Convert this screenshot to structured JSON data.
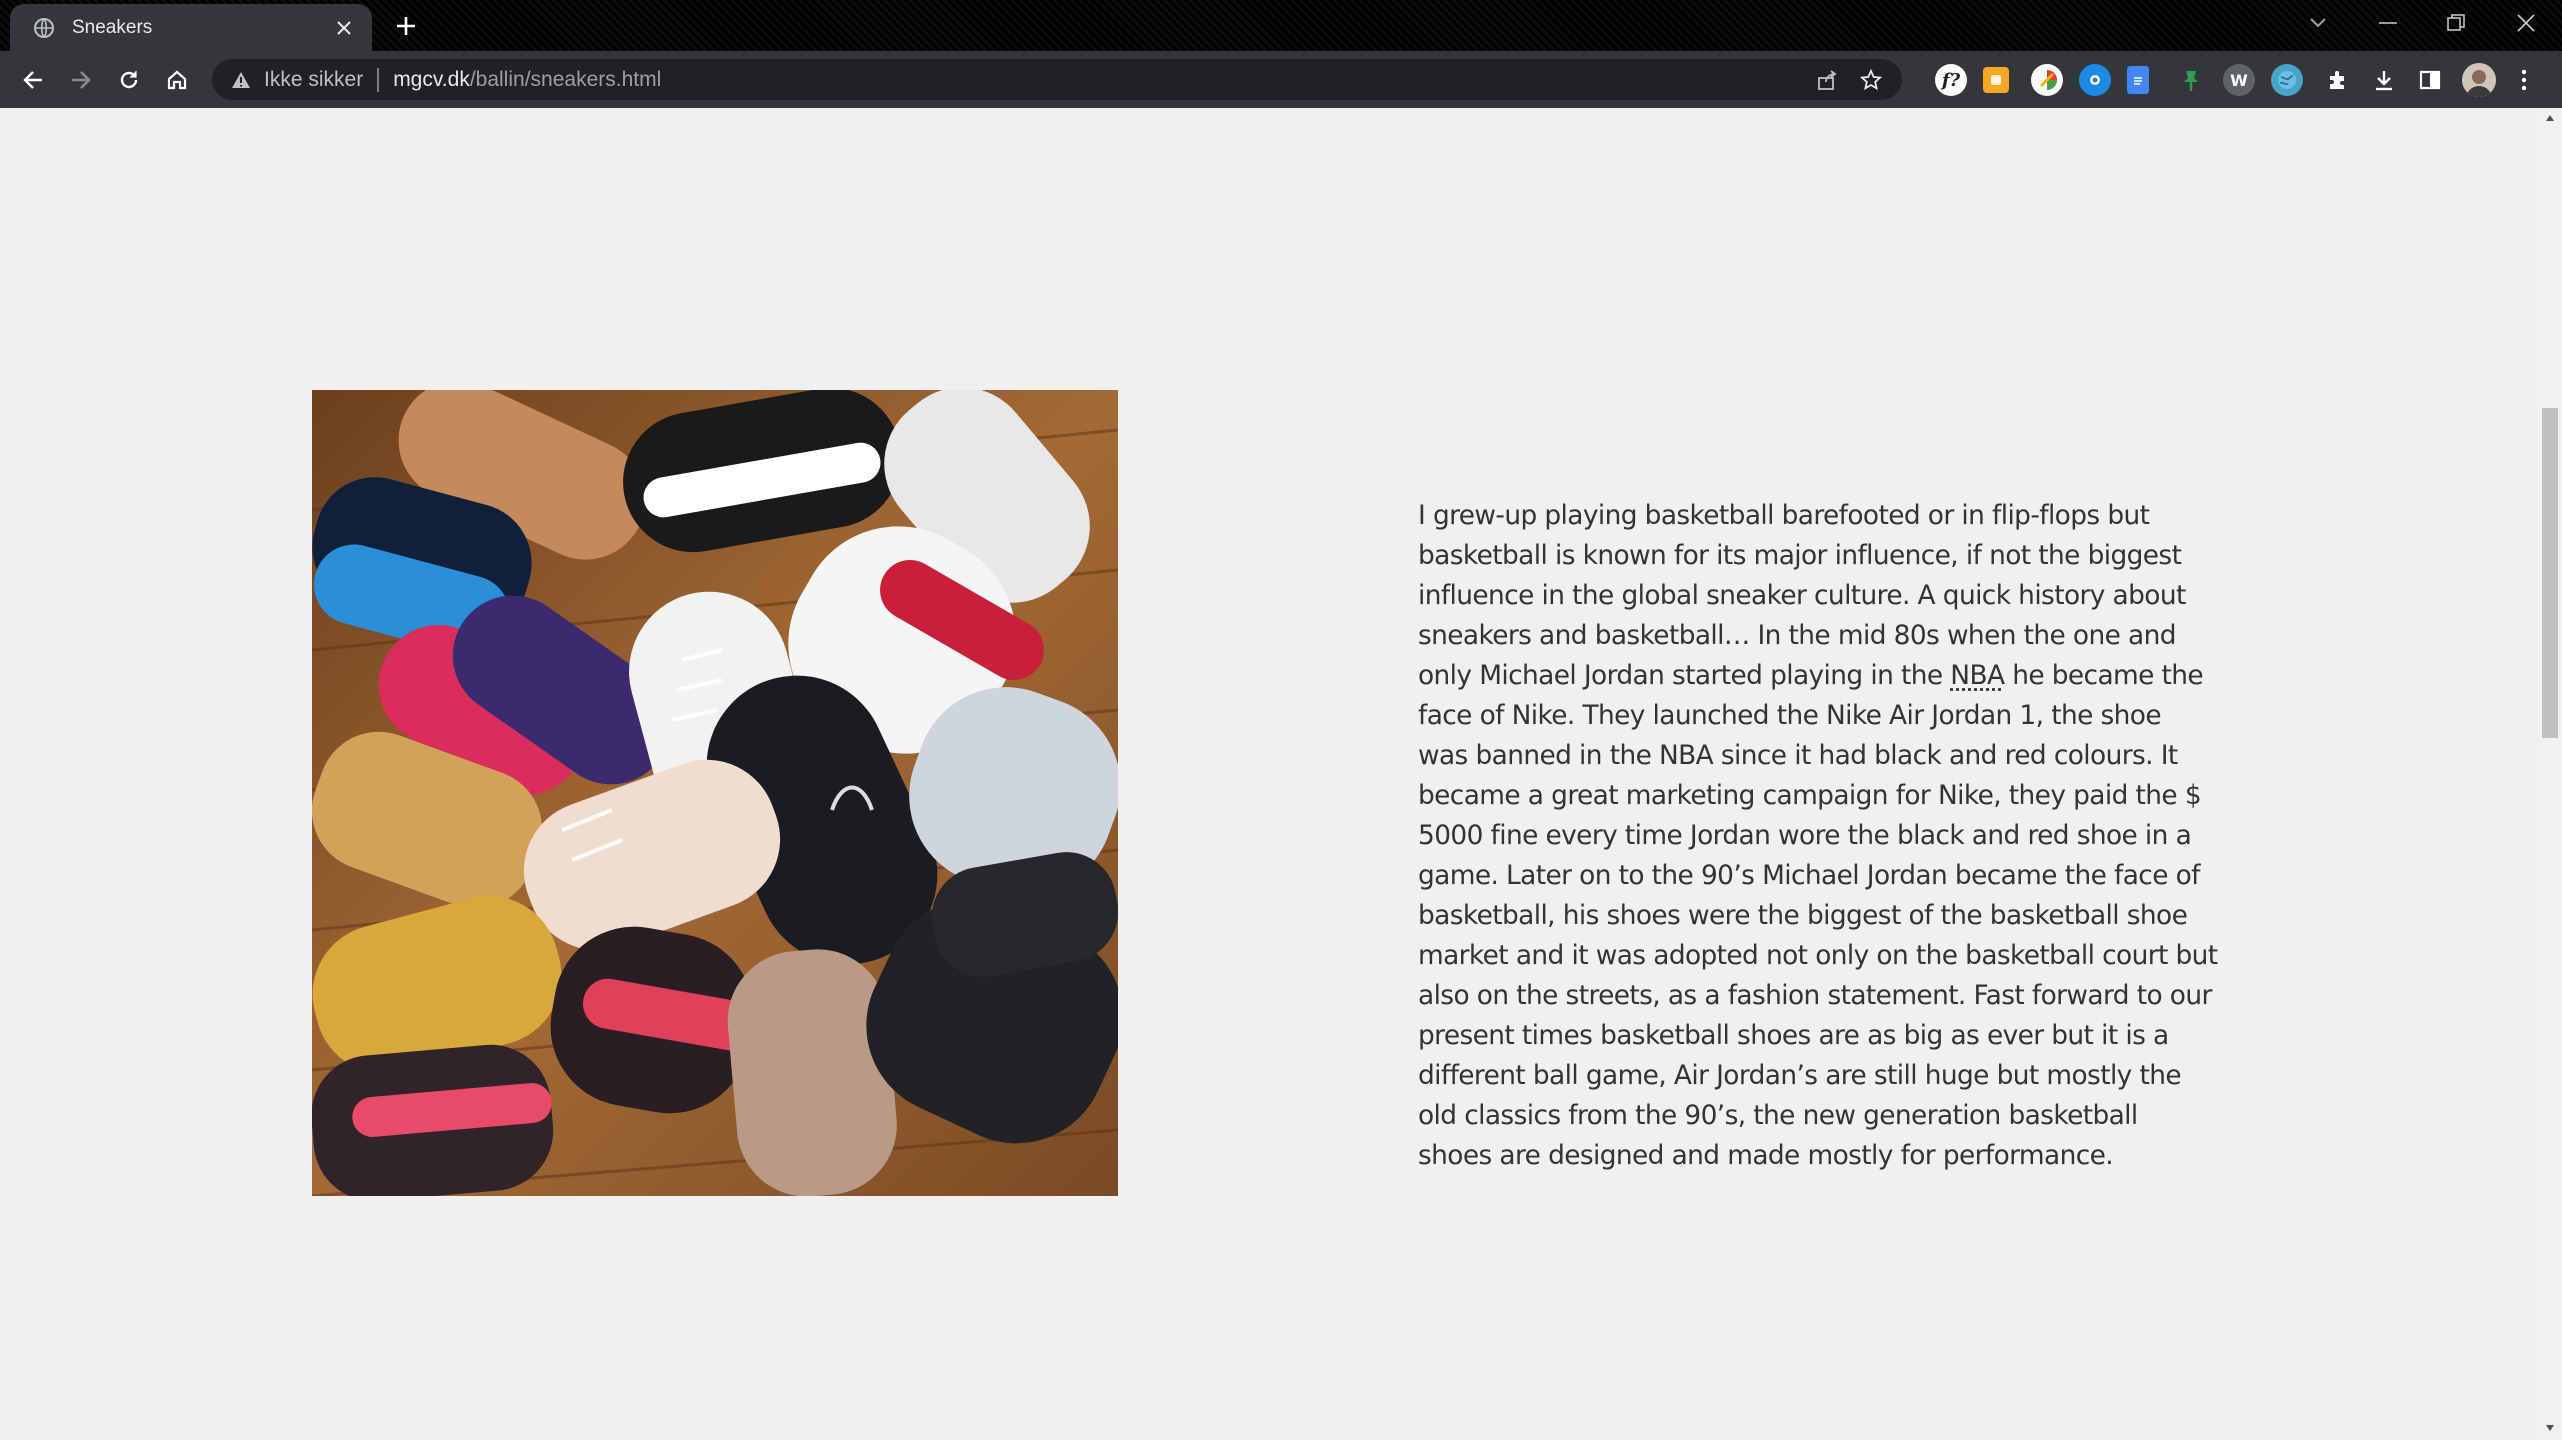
{
  "browser": {
    "tab": {
      "title": "Sneakers"
    },
    "address_bar": {
      "security_label": "Ikke sikker",
      "host": "mgcv.dk",
      "path": "/ballin/sneakers.html"
    },
    "extensions": [
      "f?",
      "honey",
      "clockify",
      "circle",
      "docs",
      "pin",
      "W",
      "globe"
    ]
  },
  "article": {
    "image_alt": "Pile of basketball sneakers on a wooden floor",
    "text_before_abbr": "I grew-up playing basketball barefooted or in flip-flops but basketball is known for its major influence, if not the biggest influence in the global sneaker culture. A quick history about sneakers and basketball… In the mid 80s when the one and only Michael Jordan started playing in the ",
    "abbr": "NBA",
    "text_after_abbr": " he became the face of Nike. They launched the Nike Air Jordan 1, the shoe was banned in the NBA since it had black and red colours. It became a great marketing campaign for Nike, they paid the $ 5000 fine every time Jordan wore the black and red shoe in a game. Later on to the 90’s Michael Jordan became the face of basketball, his shoes were the biggest of the basketball shoe market and it was adopted not only on the basketball court but also on the streets, as a fashion statement. Fast forward to our present times basketball shoes are as big as ever but it is a different ball game, Air Jordan’s are still huge but mostly the old classics from the 90’s, the new generation basketball shoes are designed and made mostly for performance."
  }
}
